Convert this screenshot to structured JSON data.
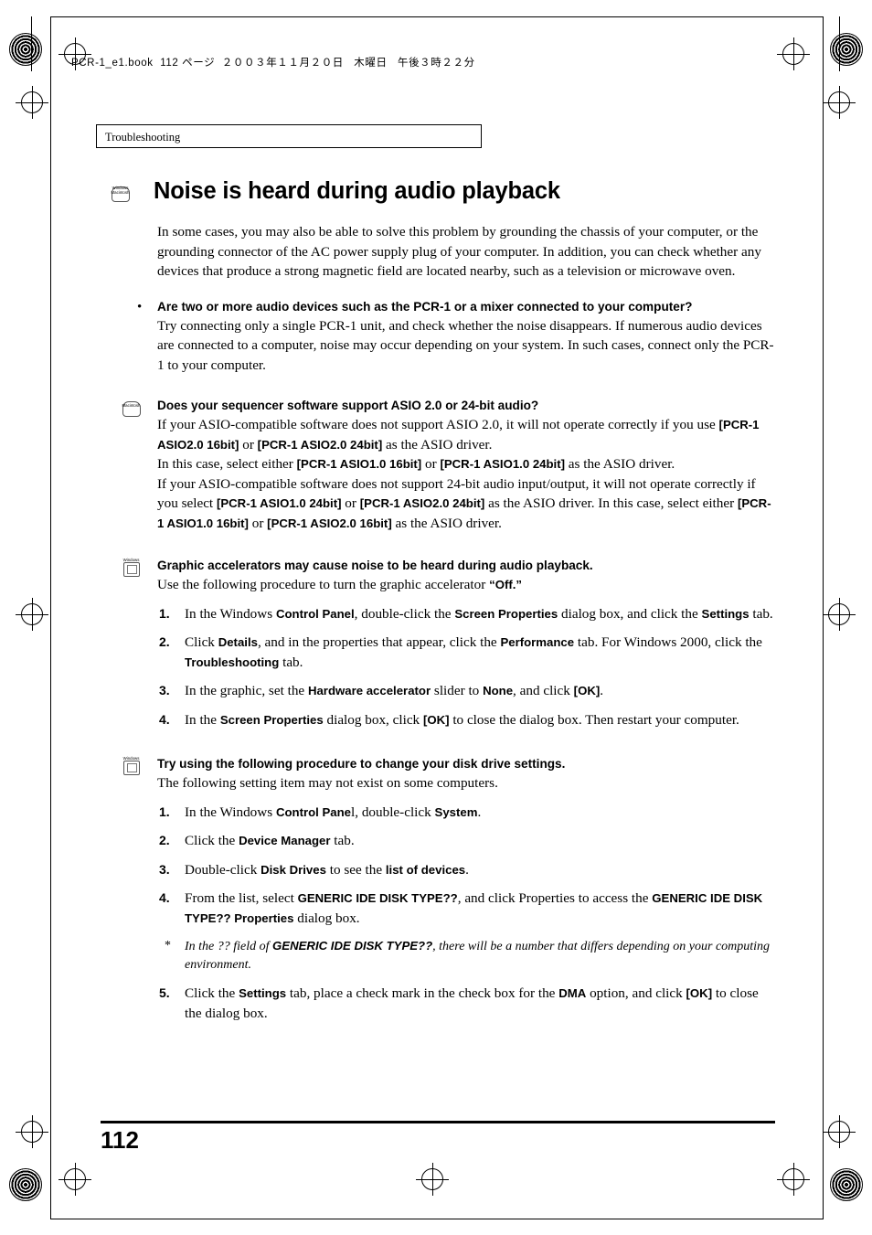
{
  "header": {
    "print_line": "PCR-1_e1.book  112 ページ  ２００３年１１月２０日   木曜日   午後３時２２分",
    "running_head": "Troubleshooting"
  },
  "title": {
    "text": "Noise is heard during audio playback",
    "badge": {
      "line1": "Windows",
      "line2": "Macintosh"
    }
  },
  "intro": "In some cases, you may also be able to solve this problem by grounding the chassis of your computer, or the grounding connector of the AC power supply plug of your computer. In addition, you can check whether any devices that produce a strong magnetic field are located nearby, such as a television or microwave oven.",
  "bullet": {
    "marker": "•",
    "question": "Are two or more audio devices such as the PCR-1 or a mixer connected to your computer?",
    "answer": "Try connecting only a single PCR-1 unit, and check whether the noise disappears. If numerous audio devices are connected to a computer, noise may occur depending on your system. In such cases, connect only the PCR-1 to your computer."
  },
  "section_asio": {
    "badge": "Macintosh",
    "heading": "Does your sequencer software support ASIO 2.0 or 24-bit audio?",
    "line1_a": "If your ASIO-compatible software does not support ASIO 2.0, it will not operate correctly if you use ",
    "line1_b": "[PCR-1 ASIO2.0 16bit]",
    "line1_c": " or ",
    "line1_d": "[PCR-1 ASIO2.0 24bit]",
    "line1_e": " as the ASIO driver.",
    "line2_a": "In this case, select either ",
    "line2_b": "[PCR-1 ASIO1.0 16bit]",
    "line2_c": " or ",
    "line2_d": "[PCR-1 ASIO1.0 24bit]",
    "line2_e": " as the ASIO driver.",
    "line3_a": "If your ASIO-compatible software does not support 24-bit audio input/output, it will not operate correctly if you select ",
    "line3_b": "[PCR-1 ASIO1.0 24bit]",
    "line3_c": " or ",
    "line3_d": "[PCR-1 ASIO2.0 24bit]",
    "line3_e": " as the ASIO driver. In this case, select either ",
    "line3_f": "[PCR-1 ASIO1.0 16bit]",
    "line3_g": " or ",
    "line3_h": "[PCR-1 ASIO2.0 16bit]",
    "line3_i": " as the ASIO driver."
  },
  "section_graphic": {
    "badge": "Windows",
    "heading": "Graphic accelerators may cause noise to be heard during audio playback.",
    "lead_a": "Use the following procedure to turn the graphic accelerator ",
    "lead_b": "“Off.”",
    "steps": [
      {
        "num": "1.",
        "parts": [
          {
            "t": "In the Windows ",
            "b": false
          },
          {
            "t": "Control Panel",
            "b": true
          },
          {
            "t": ", double-click the ",
            "b": false
          },
          {
            "t": "Screen Properties",
            "b": true
          },
          {
            "t": " dialog box, and click the ",
            "b": false
          },
          {
            "t": "Settings",
            "b": true
          },
          {
            "t": " tab.",
            "b": false
          }
        ]
      },
      {
        "num": "2.",
        "parts": [
          {
            "t": "Click ",
            "b": false
          },
          {
            "t": "Details",
            "b": true
          },
          {
            "t": ", and in the properties that appear, click the ",
            "b": false
          },
          {
            "t": "Performance",
            "b": true
          },
          {
            "t": " tab. For Windows 2000, click the ",
            "b": false
          },
          {
            "t": "Troubleshooting",
            "b": true
          },
          {
            "t": " tab.",
            "b": false
          }
        ]
      },
      {
        "num": "3.",
        "parts": [
          {
            "t": "In the graphic, set the ",
            "b": false
          },
          {
            "t": "Hardware accelerator",
            "b": true
          },
          {
            "t": " slider to ",
            "b": false
          },
          {
            "t": "None",
            "b": true
          },
          {
            "t": ", and click ",
            "b": false
          },
          {
            "t": "[OK]",
            "b": true
          },
          {
            "t": ".",
            "b": false
          }
        ]
      },
      {
        "num": "4.",
        "parts": [
          {
            "t": "In the ",
            "b": false
          },
          {
            "t": "Screen Properties",
            "b": true
          },
          {
            "t": " dialog box, click ",
            "b": false
          },
          {
            "t": "[OK]",
            "b": true
          },
          {
            "t": " to close the dialog box. Then restart your computer.",
            "b": false
          }
        ]
      }
    ]
  },
  "section_disk": {
    "badge": "Windows",
    "heading": "Try using the following procedure to change your disk drive settings.",
    "lead": "The following setting item may not exist on some computers.",
    "steps": [
      {
        "num": "1.",
        "parts": [
          {
            "t": "In the Windows ",
            "b": false
          },
          {
            "t": "Control Pane",
            "b": true
          },
          {
            "t": "l, double-click ",
            "b": false
          },
          {
            "t": "System",
            "b": true
          },
          {
            "t": ".",
            "b": false
          }
        ]
      },
      {
        "num": "2.",
        "parts": [
          {
            "t": "Click the ",
            "b": false
          },
          {
            "t": "Device Manager",
            "b": true
          },
          {
            "t": " tab.",
            "b": false
          }
        ]
      },
      {
        "num": "3.",
        "parts": [
          {
            "t": "Double-click ",
            "b": false
          },
          {
            "t": "Disk Drives",
            "b": true
          },
          {
            "t": " to see the ",
            "b": false
          },
          {
            "t": "list of devices",
            "b": true
          },
          {
            "t": ".",
            "b": false
          }
        ]
      },
      {
        "num": "4.",
        "parts": [
          {
            "t": "From the list, select ",
            "b": false
          },
          {
            "t": "GENERIC IDE DISK TYPE??",
            "b": true
          },
          {
            "t": ", and click Properties to access the ",
            "b": false
          },
          {
            "t": "GENERIC IDE DISK TYPE?? Properties",
            "b": true
          },
          {
            "t": " dialog box.",
            "b": false
          }
        ]
      }
    ],
    "note": {
      "star": "*",
      "a": "In the ?? field of ",
      "b": "GENERIC IDE DISK TYPE??",
      "c": ", there will be a number that differs depending on your computing environment."
    },
    "step5": {
      "num": "5.",
      "parts": [
        {
          "t": "Click the ",
          "b": false
        },
        {
          "t": "Settings",
          "b": true
        },
        {
          "t": " tab, place a check mark in the check box for the ",
          "b": false
        },
        {
          "t": "DMA",
          "b": true
        },
        {
          "t": " option, and click ",
          "b": false
        },
        {
          "t": "[OK]",
          "b": true
        },
        {
          "t": " to close the dialog box.",
          "b": false
        }
      ]
    }
  },
  "footer": {
    "page_number": "112"
  }
}
